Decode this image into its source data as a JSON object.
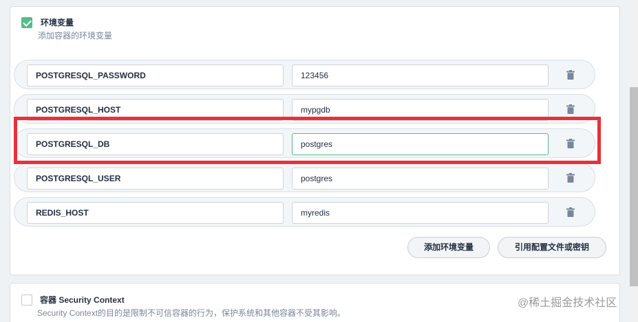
{
  "env_section": {
    "checked": true,
    "title": "环境变量",
    "description": "添加容器的环境变量",
    "rows": [
      {
        "key": "POSTGRESQL_PASSWORD",
        "value": "123456"
      },
      {
        "key": "POSTGRESQL_HOST",
        "value": "mypgdb"
      },
      {
        "key": "POSTGRESQL_DB",
        "value": "postgres",
        "focused": true
      },
      {
        "key": "POSTGRESQL_USER",
        "value": "postgres"
      },
      {
        "key": "REDIS_HOST",
        "value": "myredis"
      }
    ],
    "add_button": "添加环境变量",
    "reference_button": "引用配置文件或密钥"
  },
  "security_section": {
    "checked": false,
    "title": "容器 Security Context",
    "description": "Security Context的目的是限制不可信容器的行为，保护系统和其他容器不受其影响。"
  },
  "watermark": "@稀土掘金技术社区",
  "colors": {
    "accent": "#55bc8a",
    "highlight": "#e83138"
  },
  "icons": {
    "delete": "trash-icon",
    "check": "checkmark-icon"
  }
}
